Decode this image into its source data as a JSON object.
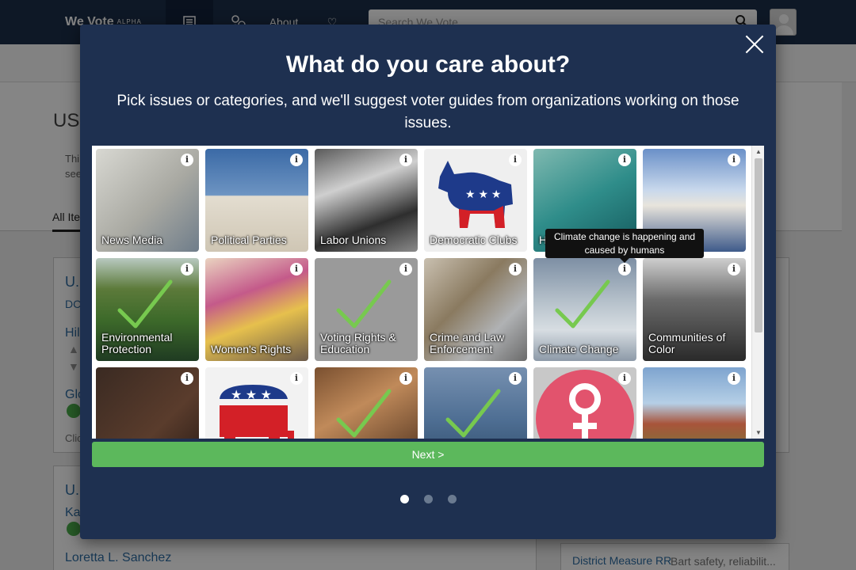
{
  "header": {
    "brand": "We Vote",
    "brand_tag": "ALPHA",
    "nav_about": "About",
    "search_placeholder": "Search We Vote"
  },
  "background": {
    "title": "US",
    "intro_line1": "Thi",
    "intro_line2": "see",
    "tab_all": "All Ite",
    "card1_title": "U.",
    "card1_sub": "DC",
    "card1_line": "Hil",
    "card1_link": "Glo",
    "card1_click": "Clic",
    "card2_title": "U.",
    "card2_line": "Ka",
    "card2_name": "Loretta L. Sanchez",
    "measure_link": "District Measure RR",
    "measure_text": "Bart safety, reliabilit..."
  },
  "modal": {
    "title": "What do you care about?",
    "subtitle": "Pick issues or categories, and we'll suggest voter guides from organizations working on those issues.",
    "tooltip": "Climate change is happening and caused by humans",
    "next_button": "Next >",
    "info_glyph": "i",
    "accent_color": "#77c94f",
    "pages": [
      {
        "active": true
      },
      {
        "active": false
      },
      {
        "active": false
      }
    ]
  },
  "issues": [
    {
      "label": "News Media",
      "selected": false,
      "icon": "newspaper"
    },
    {
      "label": "Political Parties",
      "selected": false,
      "icon": "capitol"
    },
    {
      "label": "Labor Unions",
      "selected": false,
      "icon": "protest-signs"
    },
    {
      "label": "Democratic Clubs",
      "selected": false,
      "icon": "donkey"
    },
    {
      "label": "Health and Healt",
      "selected": false,
      "icon": "surgeons"
    },
    {
      "label": "",
      "selected": false,
      "icon": "white-house-rainbow"
    },
    {
      "label": "Environmental Protection",
      "selected": true,
      "icon": "river-landscape"
    },
    {
      "label": "Women's Rights",
      "selected": false,
      "icon": "protest-sign"
    },
    {
      "label": "Voting Rights & Education",
      "selected": true,
      "icon": "gray"
    },
    {
      "label": "Crime and Law Enforcement",
      "selected": false,
      "icon": "bullets"
    },
    {
      "label": "Climate Change",
      "selected": true,
      "icon": "polar-bear"
    },
    {
      "label": "Communities of Color",
      "selected": false,
      "icon": "crowd"
    },
    {
      "label": "",
      "selected": false,
      "icon": "conservative-tiles"
    },
    {
      "label": "",
      "selected": false,
      "icon": "elephant"
    },
    {
      "label": "",
      "selected": true,
      "icon": "students"
    },
    {
      "label": "",
      "selected": true,
      "icon": "statue-of-liberty"
    },
    {
      "label": "",
      "selected": false,
      "icon": "venus-symbol"
    },
    {
      "label": "",
      "selected": false,
      "icon": "house"
    }
  ]
}
